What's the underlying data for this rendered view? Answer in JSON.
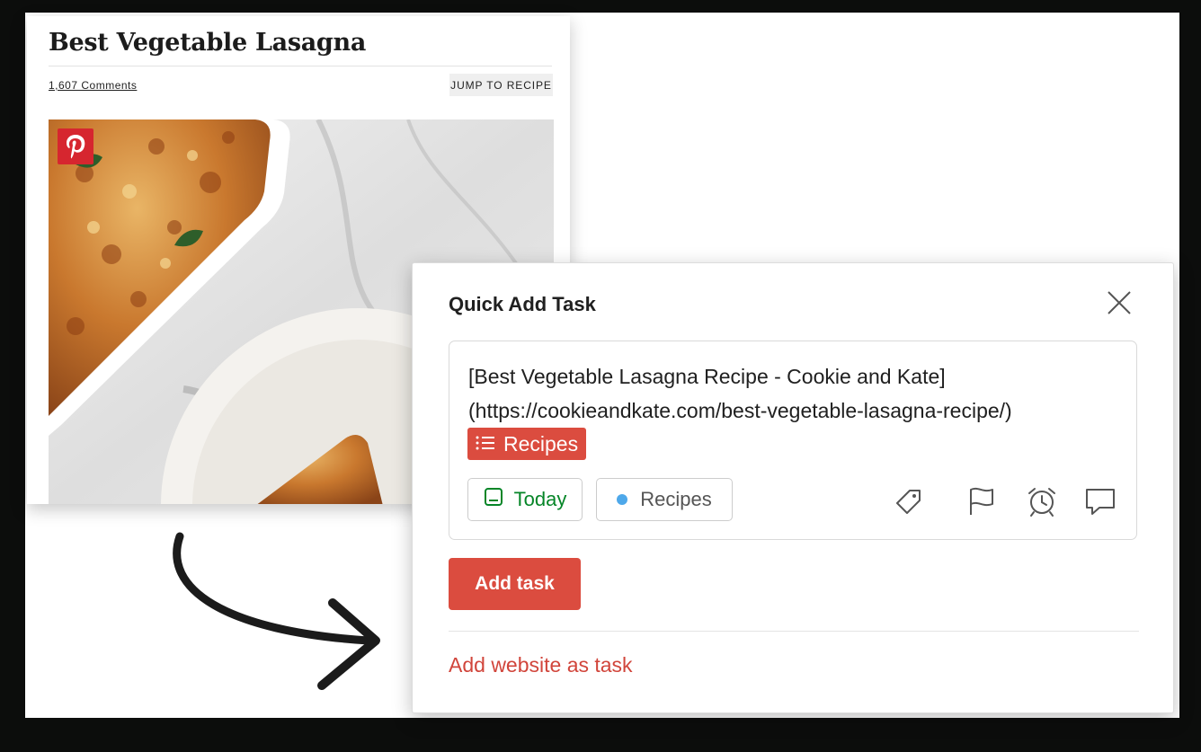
{
  "recipe_page": {
    "title": "Best Vegetable Lasagna",
    "comments_link": "1,607 Comments",
    "jump_button": "JUMP TO RECIPE",
    "pin_icon": "pinterest-icon"
  },
  "dialog": {
    "title": "Quick Add Task",
    "close_icon": "close-icon",
    "task_text": "[Best Vegetable Lasagna Recipe - Cookie and Kate]\n(https://cookieandkate.com/best-vegetable-lasagna-recipe/)",
    "tag_chip": {
      "label": "Recipes",
      "icon": "list-icon"
    },
    "schedule_button": {
      "label": "Today",
      "icon": "calendar-icon",
      "color": "#058527"
    },
    "project_button": {
      "label": "Recipes",
      "dot_color": "#4ea8ea"
    },
    "toolbar_icons": [
      "label-icon",
      "flag-icon",
      "alarm-icon",
      "comment-icon"
    ],
    "add_button": "Add task",
    "website_link": "Add website as task",
    "accent_color": "#db4c3f"
  }
}
